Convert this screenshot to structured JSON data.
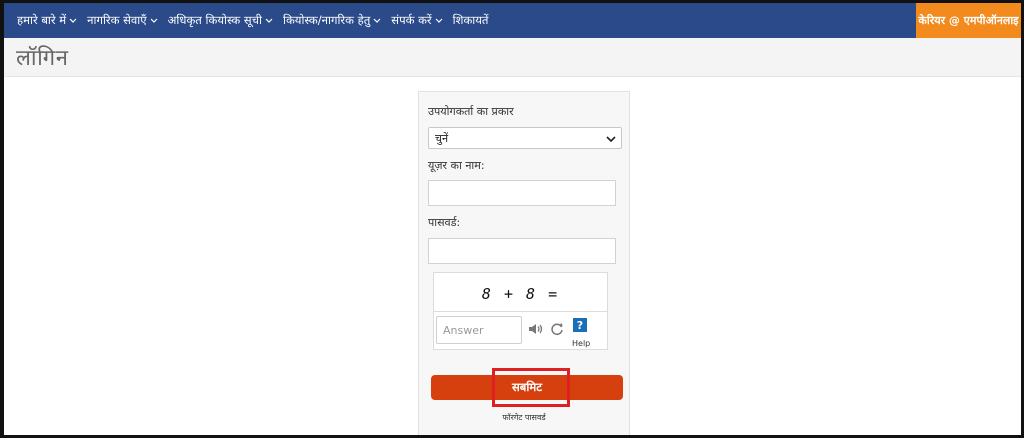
{
  "nav": {
    "items": [
      {
        "label": "हमारे बारे में"
      },
      {
        "label": "नागरिक सेवाएँ"
      },
      {
        "label": "अधिकृत कियोस्क सूची"
      },
      {
        "label": "कियोस्क/नागरिक हेतु"
      },
      {
        "label": "संपर्क करें"
      },
      {
        "label": "शिकायतें"
      }
    ],
    "career": "केरियर @ एमपीऑनलाइ"
  },
  "page": {
    "title": "लॉगिन"
  },
  "form": {
    "user_type_label": "उपयोगकर्ता का प्रकार",
    "user_type_selected": "चुनें",
    "username_label": "यूज़र का नाम:",
    "username_value": "",
    "password_label": "पासवर्ड:",
    "password_value": "",
    "captcha_expression": "8 + 8 =",
    "answer_placeholder": "Answer",
    "help_symbol": "?",
    "help_label": "Help",
    "submit_label": "सबमिट",
    "forgot_label": "फॉरगेट पासवर्ड"
  },
  "colors": {
    "navbar": "#2b4a8a",
    "career_bg": "#f28a1d",
    "submit_bg": "#d6400f",
    "highlight": "#e02020",
    "help_icon": "#1b6fb8"
  },
  "icons": {
    "nav_dropdown": "chevron-down-icon",
    "select_arrow": "chevron-down-icon",
    "audio": "speaker-icon",
    "refresh": "refresh-icon",
    "help": "help-icon"
  }
}
